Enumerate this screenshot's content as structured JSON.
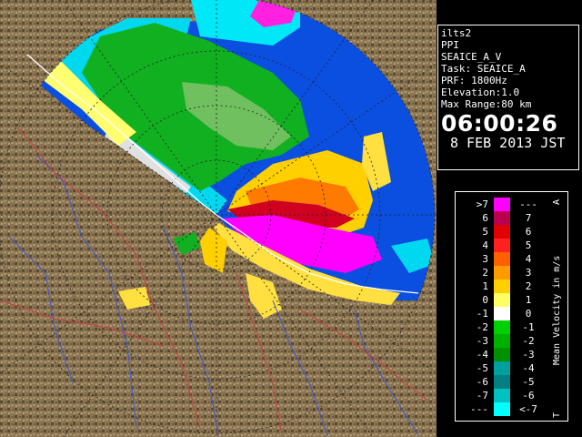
{
  "info": {
    "site": "ilts2",
    "product": "PPI",
    "field": "SEAICE_A_V",
    "task": "Task: SEAICE_A",
    "prf": "PRF: 1800Hz",
    "elevation": "Elevation:1.0",
    "max_range": "Max Range:80 km",
    "time": "06:00:26",
    "date": "8 FEB 2013 JST"
  },
  "legend": {
    "title": "Mean Velocity in m/s",
    "corner_top": "A",
    "corner_bottom": "T",
    "rows": [
      {
        "left": ">7",
        "right": "---",
        "color": "#ff00ff"
      },
      {
        "left": "6",
        "right": "7",
        "color": "#b8004f"
      },
      {
        "left": "5",
        "right": "6",
        "color": "#e00000"
      },
      {
        "left": "4",
        "right": "5",
        "color": "#ff2020"
      },
      {
        "left": "3",
        "right": "4",
        "color": "#ff6000"
      },
      {
        "left": "2",
        "right": "3",
        "color": "#ff9a00"
      },
      {
        "left": "1",
        "right": "2",
        "color": "#ffd000"
      },
      {
        "left": "0",
        "right": "1",
        "color": "#ffff66"
      },
      {
        "left": "-1",
        "right": "0",
        "color": "#ffffff"
      },
      {
        "left": "-2",
        "right": "-1",
        "color": "#00d000"
      },
      {
        "left": "-3",
        "right": "-2",
        "color": "#00b000"
      },
      {
        "left": "-4",
        "right": "-3",
        "color": "#009000"
      },
      {
        "left": "-5",
        "right": "-4",
        "color": "#00a0a0"
      },
      {
        "left": "-6",
        "right": "-5",
        "color": "#008080"
      },
      {
        "left": "-7",
        "right": "-6",
        "color": "#00c0c0"
      },
      {
        "left": "---",
        "right": "<-7",
        "color": "#00ffff"
      }
    ]
  },
  "colors": {
    "sea": "#0b4fe0",
    "terrain": "#8a7452",
    "coastline": "#ffffff",
    "rivers": "#3a5ad0",
    "roads": "#c84040"
  }
}
